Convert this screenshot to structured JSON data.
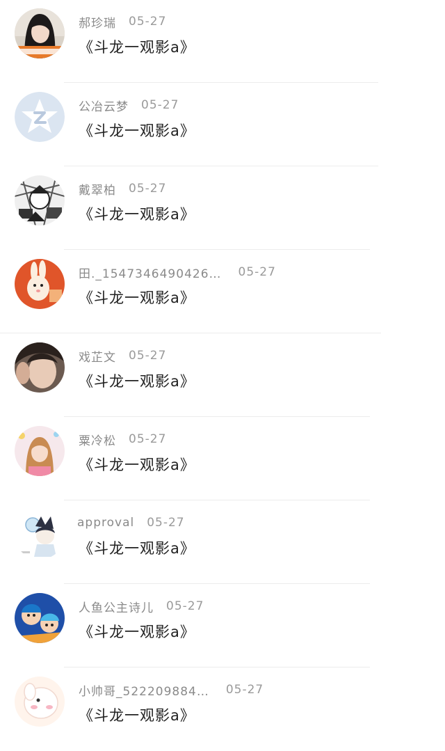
{
  "comments": [
    {
      "name": "郝珍瑞",
      "date": "05-27",
      "text": "《斗龙一观影a》",
      "avatar": "avatar-girl-photo"
    },
    {
      "name": "公冶云梦",
      "date": "05-27",
      "text": "《斗龙一观影a》",
      "avatar": "avatar-default-qq"
    },
    {
      "name": "戴翠柏",
      "date": "05-27",
      "text": "《斗龙一观影a》",
      "avatar": "avatar-manga"
    },
    {
      "name": "田._1547346490426…",
      "date": "05-27",
      "text": "《斗龙一观影a》",
      "avatar": "avatar-rabbit"
    },
    {
      "name": "戏芷文",
      "date": "05-27",
      "text": "《斗龙一观影a》",
      "avatar": "avatar-boy-photo"
    },
    {
      "name": "粟冷松",
      "date": "05-27",
      "text": "《斗龙一观影a》",
      "avatar": "avatar-girl-pink"
    },
    {
      "name": "approval",
      "date": "05-27",
      "text": "《斗龙一观影a》",
      "avatar": "avatar-anime-cat"
    },
    {
      "name": "人鱼公主诗儿",
      "date": "05-27",
      "text": "《斗龙一观影a》",
      "avatar": "avatar-cartoon-kids"
    },
    {
      "name": "小帅哥_522209884…",
      "date": "05-27",
      "text": "《斗龙一观影a》",
      "avatar": "avatar-pink-bunny"
    }
  ]
}
